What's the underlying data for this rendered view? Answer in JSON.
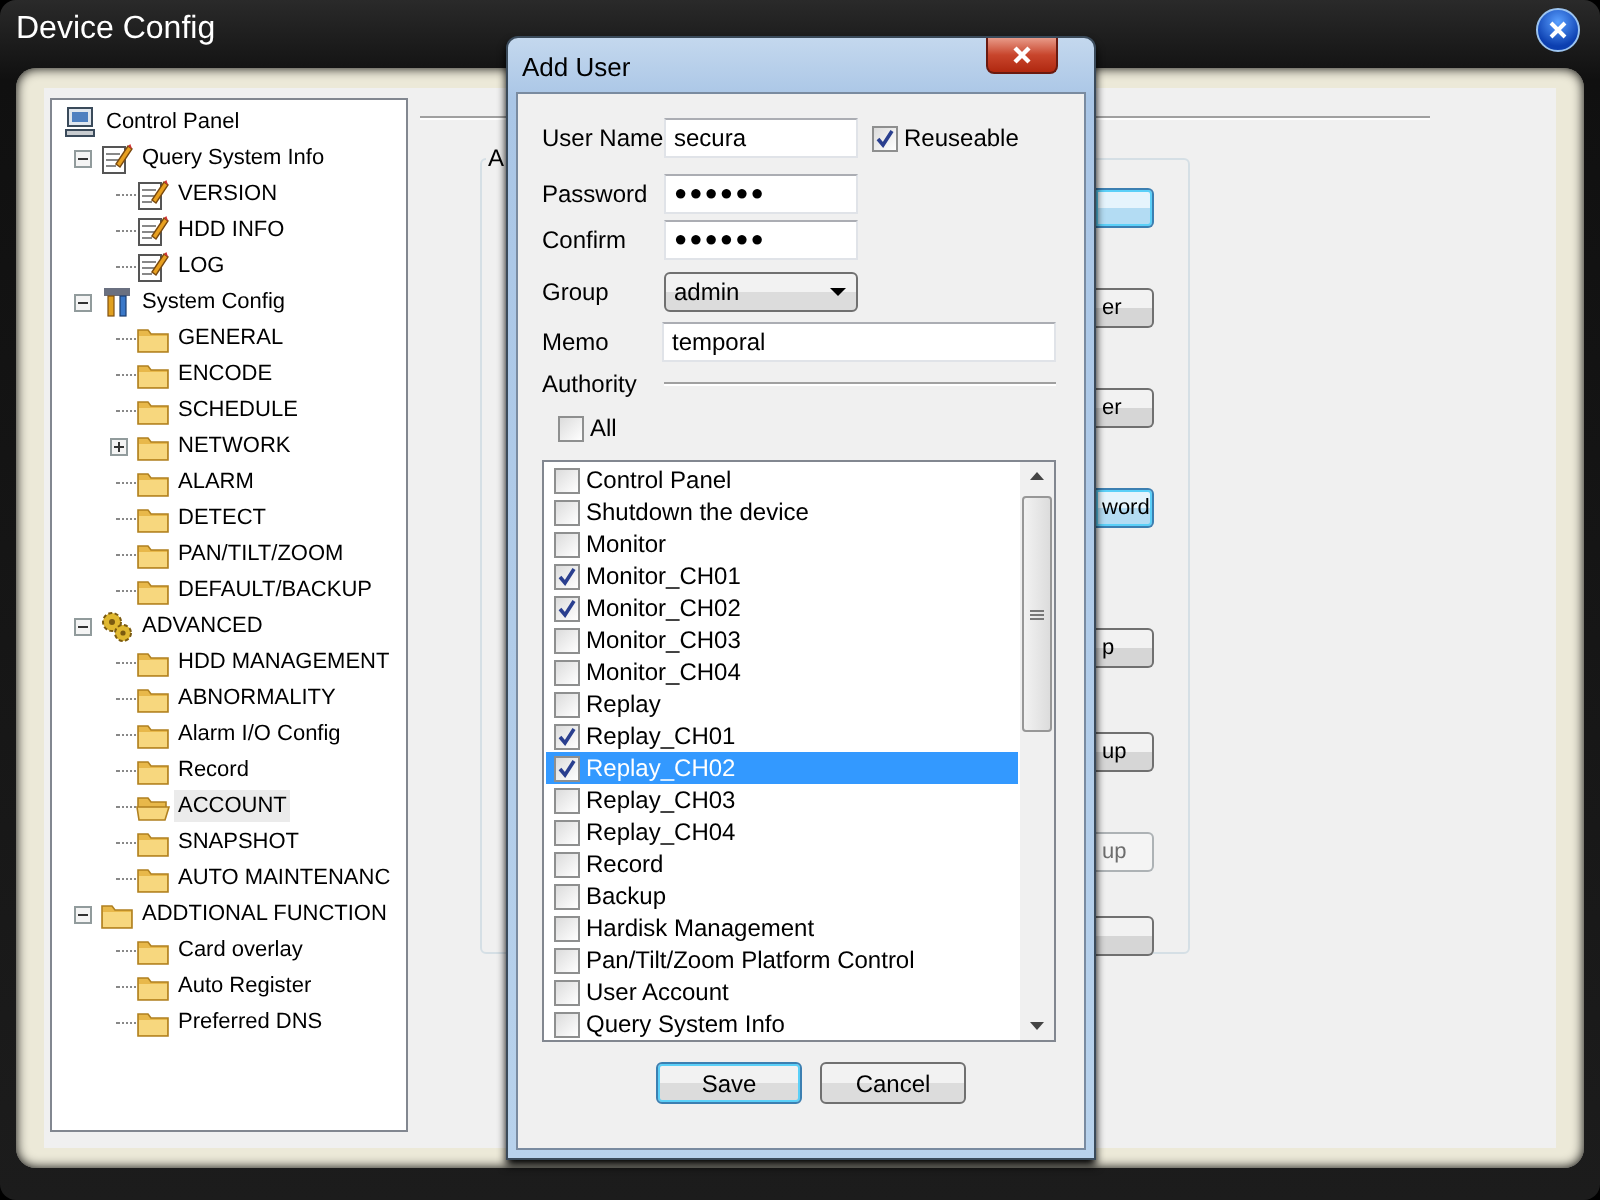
{
  "window": {
    "title": "Device Config"
  },
  "tree": [
    {
      "label": "Control Panel",
      "kind": "computer",
      "selected": false,
      "children": [
        {
          "label": "Query System Info",
          "kind": "notepad",
          "selected": false,
          "expanded": true,
          "children": [
            {
              "label": "VERSION",
              "kind": "notepad",
              "selected": false
            },
            {
              "label": "HDD INFO",
              "kind": "notepad",
              "selected": false
            },
            {
              "label": "LOG",
              "kind": "notepad",
              "selected": false
            }
          ]
        },
        {
          "label": "System Config",
          "kind": "tools",
          "selected": false,
          "expanded": true,
          "children": [
            {
              "label": "GENERAL",
              "kind": "folder",
              "selected": false
            },
            {
              "label": "ENCODE",
              "kind": "folder",
              "selected": false
            },
            {
              "label": "SCHEDULE",
              "kind": "folder",
              "selected": false
            },
            {
              "label": "NETWORK",
              "kind": "folder",
              "selected": false,
              "expanded": false
            },
            {
              "label": "ALARM",
              "kind": "folder",
              "selected": false
            },
            {
              "label": "DETECT",
              "kind": "folder",
              "selected": false
            },
            {
              "label": "PAN/TILT/ZOOM",
              "kind": "folder",
              "selected": false
            },
            {
              "label": "DEFAULT/BACKUP",
              "kind": "folder",
              "selected": false
            }
          ]
        },
        {
          "label": "ADVANCED",
          "kind": "gears",
          "selected": false,
          "expanded": true,
          "children": [
            {
              "label": "HDD MANAGEMENT",
              "kind": "folder",
              "selected": false
            },
            {
              "label": "ABNORMALITY",
              "kind": "folder",
              "selected": false
            },
            {
              "label": "Alarm I/O Config",
              "kind": "folder",
              "selected": false
            },
            {
              "label": "Record",
              "kind": "folder",
              "selected": false
            },
            {
              "label": "ACCOUNT",
              "kind": "open-folder",
              "selected": true
            },
            {
              "label": "SNAPSHOT",
              "kind": "folder",
              "selected": false
            },
            {
              "label": "AUTO MAINTENANC",
              "kind": "folder",
              "selected": false
            }
          ]
        },
        {
          "label": "ADDTIONAL FUNCTION",
          "kind": "folder",
          "selected": false,
          "expanded": true,
          "children": [
            {
              "label": "Card overlay",
              "kind": "folder",
              "selected": false
            },
            {
              "label": "Auto Register",
              "kind": "folder",
              "selected": false
            },
            {
              "label": "Preferred DNS",
              "kind": "folder",
              "selected": false
            }
          ]
        }
      ]
    }
  ],
  "panel": {
    "group_label": "A",
    "buttons": [
      {
        "focused": true,
        "disabled": false
      },
      {
        "label": "er",
        "focused": false,
        "disabled": false
      },
      {
        "label": "er",
        "focused": false,
        "disabled": false
      },
      {
        "label": "word",
        "focused": true,
        "disabled": false
      },
      {
        "label": "p",
        "focused": false,
        "disabled": false
      },
      {
        "label": "up",
        "focused": false,
        "disabled": false
      },
      {
        "label": "up",
        "focused": false,
        "disabled": true
      },
      {
        "focused": false,
        "disabled": false
      }
    ]
  },
  "dialog": {
    "title": "Add User",
    "user_name": {
      "label": "User Name",
      "value": "secura"
    },
    "reuseable": {
      "label": "Reuseable",
      "checked": true
    },
    "password": {
      "label": "Password",
      "value": "●●●●●●"
    },
    "confirm": {
      "label": "Confirm",
      "value": "●●●●●●"
    },
    "group": {
      "label": "Group",
      "value": "admin"
    },
    "memo": {
      "label": "Memo",
      "value": "temporal"
    },
    "authority": {
      "label": "Authority"
    },
    "all": {
      "label": "All",
      "checked": false
    },
    "permissions": [
      {
        "label": "Control Panel",
        "checked": false,
        "selected": false
      },
      {
        "label": "Shutdown the device",
        "checked": false,
        "selected": false
      },
      {
        "label": "Monitor",
        "checked": false,
        "selected": false
      },
      {
        "label": "Monitor_CH01",
        "checked": true,
        "selected": false
      },
      {
        "label": "Monitor_CH02",
        "checked": true,
        "selected": false
      },
      {
        "label": "Monitor_CH03",
        "checked": false,
        "selected": false
      },
      {
        "label": "Monitor_CH04",
        "checked": false,
        "selected": false
      },
      {
        "label": "Replay",
        "checked": false,
        "selected": false
      },
      {
        "label": "Replay_CH01",
        "checked": true,
        "selected": false
      },
      {
        "label": "Replay_CH02",
        "checked": true,
        "selected": true
      },
      {
        "label": "Replay_CH03",
        "checked": false,
        "selected": false
      },
      {
        "label": "Replay_CH04",
        "checked": false,
        "selected": false
      },
      {
        "label": "Record",
        "checked": false,
        "selected": false
      },
      {
        "label": "Backup",
        "checked": false,
        "selected": false
      },
      {
        "label": "Hardisk Management",
        "checked": false,
        "selected": false
      },
      {
        "label": "Pan/Tilt/Zoom Platform Control",
        "checked": false,
        "selected": false
      },
      {
        "label": "User Account",
        "checked": false,
        "selected": false
      },
      {
        "label": "Query System Info",
        "checked": false,
        "selected": false
      }
    ],
    "buttons": [
      {
        "label": "Save",
        "default": true
      },
      {
        "label": "Cancel",
        "default": false
      }
    ]
  }
}
